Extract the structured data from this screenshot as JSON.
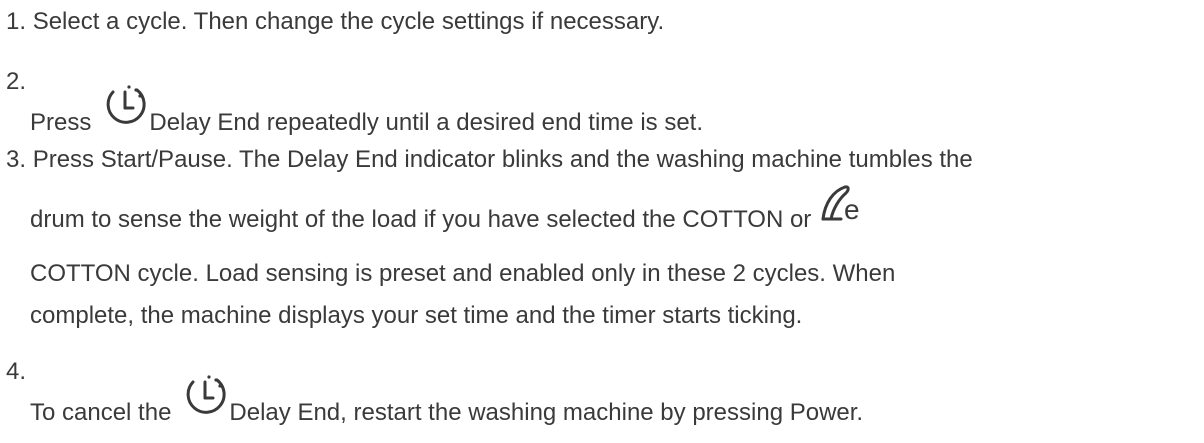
{
  "steps": [
    {
      "number": "1.",
      "text": "Select a cycle. Then change the cycle settings if necessary."
    },
    {
      "number": "2.",
      "before_icon": "Press",
      "icon": "delay-end-clock-icon",
      "after_icon": "Delay End repeatedly until a desired end time is set."
    },
    {
      "number": "3.",
      "line1": "Press Start/Pause. The Delay End indicator blinks and the washing machine tumbles the",
      "line2_before_icon": "drum to sense the weight of the load if you have selected the COTTON or",
      "icon": "eco-cotton-icon",
      "line3": "COTTON cycle. Load sensing is preset and enabled only in these 2 cycles. When",
      "line4": "complete, the machine displays your set time and the timer starts ticking."
    },
    {
      "number": "4.",
      "before_icon": "To cancel the",
      "icon": "delay-end-clock-icon",
      "after_icon": "Delay End, restart the washing machine by pressing Power."
    }
  ],
  "colors": {
    "text": "#3a3a3a",
    "icon": "#3a3a3a"
  }
}
